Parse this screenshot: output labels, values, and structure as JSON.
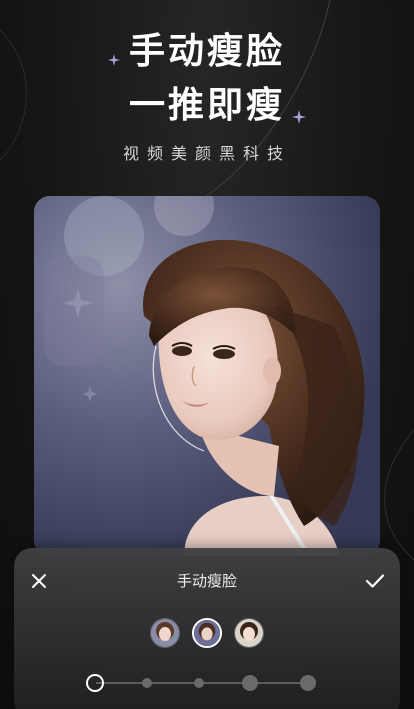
{
  "promo": {
    "headline_line1": "手动瘦脸",
    "headline_line2": "一推即瘦",
    "subtitle": "视频美颜黑科技"
  },
  "editor_panel": {
    "title": "手动瘦脸",
    "close_icon": "close-icon",
    "confirm_icon": "checkmark-icon",
    "avatars": [
      {
        "name": "face-preview-1",
        "selected": false
      },
      {
        "name": "face-preview-2",
        "selected": true
      },
      {
        "name": "face-preview-3",
        "selected": false
      }
    ],
    "slider": {
      "stops": 5,
      "selected_index": 0
    }
  },
  "colors": {
    "background": "#161616",
    "text_primary": "#ffffff",
    "panel_bg": "#3a3a3c",
    "slider_track": "#5e5e60"
  }
}
